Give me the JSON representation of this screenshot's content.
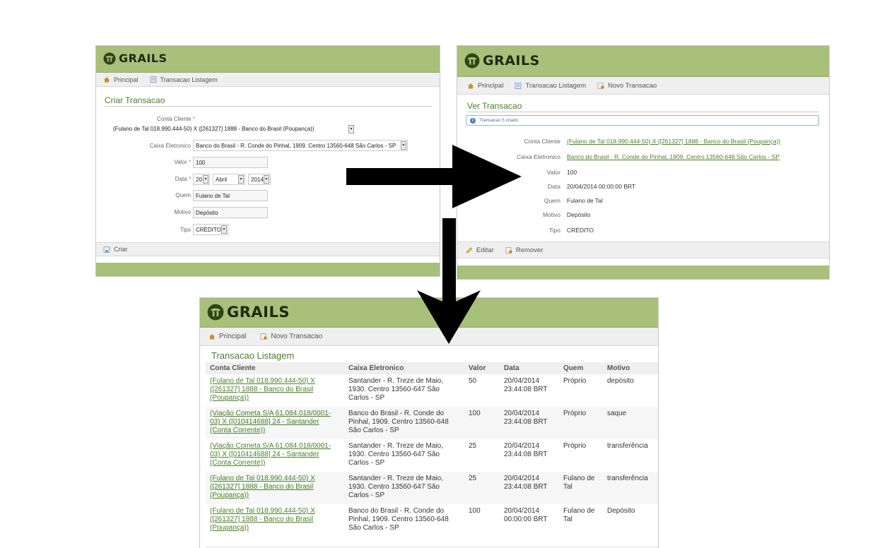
{
  "brand": "GRAILS",
  "create": {
    "nav": [
      "Principal",
      "Transacao Listagem"
    ],
    "title": "Criar Transacao",
    "labels": {
      "conta": "Conta Cliente",
      "caixa": "Caixa Eletronico",
      "valor": "Valor",
      "data": "Data",
      "quem": "Quem",
      "motivo": "Motivo",
      "tipo": "Tipo"
    },
    "required": "*",
    "values": {
      "conta": "(Fulano de Tal 018.990.444-50) X ([261327] 1888 - Banco do Brasil (Poupança))",
      "caixa": "Banco do Brasil - R. Conde do Pinhal, 1909. Centro 13560-648 São Carlos - SP",
      "valor": "100",
      "day": "20",
      "month": "Abril",
      "year": "2014",
      "quem": "Fulano de Tal",
      "motivo": "Depósito",
      "tipo": "CRÉDITO"
    },
    "button": "Criar"
  },
  "show": {
    "nav": [
      "Principal",
      "Transacao Listagem",
      "Novo Transacao"
    ],
    "title": "Ver Transacao",
    "message": "Transacao 5 criado",
    "fields": [
      {
        "label": "Conta Cliente",
        "value": "(Fulano de Tal 018.990.444-50) X ([261327] 1888 - Banco do Brasil (Poupança))"
      },
      {
        "label": "Caixa Eletronico",
        "value": "Banco do Brasil - R. Conde do Pinhal, 1909. Centro 13560-648 São Carlos - SP"
      },
      {
        "label": "Valor",
        "value": "100"
      },
      {
        "label": "Data",
        "value": "20/04/2014 00:00:00 BRT"
      },
      {
        "label": "Quem",
        "value": "Fulano de Tal"
      },
      {
        "label": "Motivo",
        "value": "Depósito"
      },
      {
        "label": "Tipo",
        "value": "CRÉDITO"
      }
    ],
    "buttons": [
      "Editar",
      "Remover"
    ]
  },
  "list": {
    "nav": [
      "Principal",
      "Novo Transacao"
    ],
    "title": "Transacao Listagem",
    "columns": [
      "Conta Cliente",
      "Caixa Eletronico",
      "Valor",
      "Data",
      "Quem",
      "Motivo"
    ],
    "rows": [
      {
        "conta": "(Fulano de Tal 018.990.444-50) X ([261327] 1888 - Banco do Brasil (Poupança))",
        "caixa": "Santander - R. Treze de Maio, 1930. Centro 13560-647 São Carlos - SP",
        "valor": "50",
        "data": "20/04/2014 23:44:08 BRT",
        "quem": "Próprio",
        "motivo": "depósito"
      },
      {
        "conta": "(Viação Cometa S/A 61.084.018/0001-03) X ([010414688] 24 - Santander (Conta Corrente))",
        "caixa": "Banco do Brasil - R. Conde do Pinhal, 1909. Centro 13560-648 São Carlos - SP",
        "valor": "100",
        "data": "20/04/2014 23:44:08 BRT",
        "quem": "Próprio",
        "motivo": "saque"
      },
      {
        "conta": "(Viação Cometa S/A 61.084.018/0001-03) X ([010414688] 24 - Santander (Conta Corrente))",
        "caixa": "Santander - R. Treze de Maio, 1930. Centro 13560-647 São Carlos - SP",
        "valor": "25",
        "data": "20/04/2014 23:44:08 BRT",
        "quem": "Próprio",
        "motivo": "transferência"
      },
      {
        "conta": "(Fulano de Tal 018.990.444-50) X ([261327] 1888 - Banco do Brasil (Poupança))",
        "caixa": "Santander - R. Treze de Maio, 1930. Centro 13560-647 São Carlos - SP",
        "valor": "25",
        "data": "20/04/2014 23:44:08 BRT",
        "quem": "Fulano de Tal",
        "motivo": "transferência"
      },
      {
        "conta": "(Fulano de Tal 018.990.444-50) X ([261327] 1888 - Banco do Brasil (Poupança))",
        "caixa": "Banco do Brasil - R. Conde do Pinhal, 1909. Centro 13560-648 São Carlos - SP",
        "valor": "100",
        "data": "20/04/2014 00:00:00 BRT",
        "quem": "Fulano de Tal",
        "motivo": "Depósito"
      }
    ]
  },
  "colors": {
    "header": "#a8c07a",
    "accent": "#48802c",
    "navbar": "#efefef"
  }
}
